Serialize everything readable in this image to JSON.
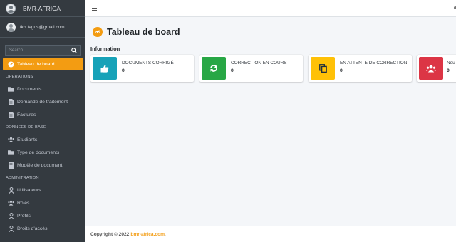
{
  "brand": {
    "name": "BMR-AFRICA"
  },
  "user": {
    "email": "tkh.tegus@gmail.com"
  },
  "search": {
    "placeholder": "Search"
  },
  "sidebar": {
    "active": {
      "label": "Tableau de board",
      "icon": "dashboard-gauge-icon"
    },
    "sections": [
      {
        "header": "OPERATIONS",
        "items": [
          {
            "label": "Documents",
            "icon": "folder-icon"
          },
          {
            "label": "Demande de traitement",
            "icon": "document-icon"
          },
          {
            "label": "Factures",
            "icon": "document-icon"
          }
        ]
      },
      {
        "header": "DONNEES DE BASE",
        "items": [
          {
            "label": "Etudiants",
            "icon": "users-icon"
          },
          {
            "label": "Type de documents",
            "icon": "folder-icon"
          },
          {
            "label": "Modèle de document",
            "icon": "book-icon"
          }
        ]
      },
      {
        "header": "ADMINITRATION",
        "items": [
          {
            "label": "Utilisateurs",
            "icon": "user-icon"
          },
          {
            "label": "Roles",
            "icon": "users-icon"
          },
          {
            "label": "Profils",
            "icon": "user-icon"
          },
          {
            "label": "Droits d'accès",
            "icon": "user-icon"
          }
        ]
      }
    ]
  },
  "page": {
    "title": "Tableau de board",
    "section": "Information"
  },
  "cards": [
    {
      "label": "DOCUMENTS CORRIGÉ",
      "value": "0",
      "icon": "thumbs-up-icon",
      "color": "#17a2b8"
    },
    {
      "label": "CORRECTION EN COURS",
      "value": "0",
      "icon": "sync-icon",
      "color": "#28a745"
    },
    {
      "label": "EN ATTENTE DE CORRECTION",
      "value": "0",
      "icon": "copy-icon",
      "color": "#ffc107"
    },
    {
      "label": "Nou",
      "value": "0",
      "icon": "users-icon",
      "color": "#dc3545"
    }
  ],
  "footer": {
    "copyright": "Copyright © 2022",
    "link": "bmr-africa.com",
    "suffix": "."
  },
  "colors": {
    "sidebar": "#343a40",
    "accent": "#f39c12"
  }
}
